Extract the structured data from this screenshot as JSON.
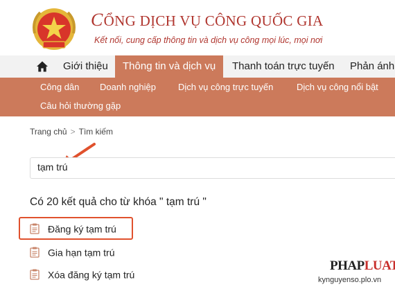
{
  "header": {
    "title_first": "C",
    "title_rest": "ỔNG DỊCH VỤ CÔNG QUỐC GIA",
    "slogan": "Kết nối, cung cấp thông tin và dịch vụ công mọi lúc, mọi nơi",
    "emblem_icon": "national-emblem-icon"
  },
  "main_nav": {
    "home_icon": "home-icon",
    "items": [
      "Giới thiệu",
      "Thông tin và dịch vụ",
      "Thanh toán trực tuyến",
      "Phản ánh"
    ],
    "active_index": 1
  },
  "sub_nav": {
    "items": [
      "Công dân",
      "Doanh nghiệp",
      "Dịch vụ công trực tuyến",
      "Dịch vụ công nổi bật",
      "Câu hỏi thường gặp"
    ]
  },
  "breadcrumb": {
    "home": "Trang chủ",
    "separator": ">",
    "current": "Tìm kiếm"
  },
  "search": {
    "value": "tạm trú"
  },
  "results": {
    "heading": "Có 20 kết quả cho từ khóa \" tạm trú \"",
    "items": [
      "Đăng ký tạm trú",
      "Gia hạn tạm trú",
      "Xóa đăng ký tạm trú"
    ],
    "item_icon": "document-icon"
  },
  "watermark": {
    "logo_part1": "PHAP",
    "logo_part2": "LUAT",
    "url": "kynguyenso.plo.vn"
  },
  "colors": {
    "brand_red": "#b0362f",
    "nav_accent": "#cc7a5b",
    "annotation_red": "#e0512d"
  }
}
